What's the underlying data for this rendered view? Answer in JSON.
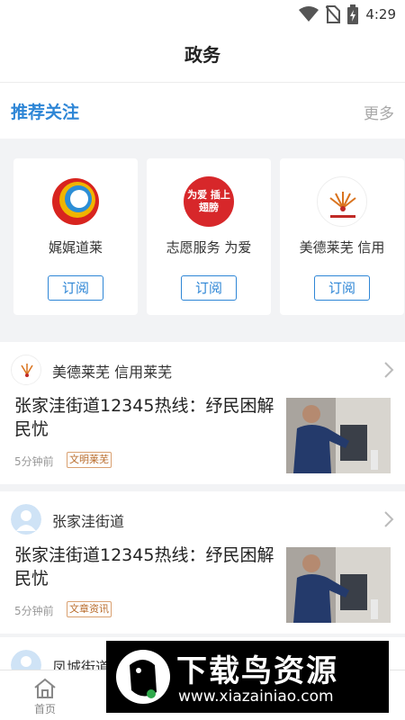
{
  "status_bar": {
    "time": "4:29"
  },
  "header": {
    "title": "政务"
  },
  "recommend": {
    "title": "推荐关注",
    "more": "更多",
    "cards": [
      {
        "name": "娓娓道莱",
        "subscribe_label": "订阅",
        "logo": "ring-logo-icon"
      },
      {
        "name": "志愿服务  为爱",
        "subscribe_label": "订阅",
        "logo": "volunteer-logo",
        "logo_text": "为爱 插上翅膀"
      },
      {
        "name": "美德莱芜  信用",
        "subscribe_label": "订阅",
        "logo": "virtue-logo-icon"
      }
    ]
  },
  "feed": [
    {
      "author": "美德莱芜  信用莱芜",
      "headline": "张家洼街道12345热线：纾民困解民忧",
      "time": "5分钟前",
      "tag": "文明莱芜"
    },
    {
      "author": "张家洼街道",
      "headline": "张家洼街道12345热线：纾民困解民忧",
      "time": "5分钟前",
      "tag": "文章资讯"
    },
    {
      "author": "凤城街道"
    }
  ],
  "bottom_nav": {
    "home_label": "首页"
  },
  "watermark": {
    "line1": "下载鸟资源",
    "line2": "www.xiazainiao.com"
  },
  "colors": {
    "accent": "#2e86d6",
    "tag": "#b86b2a",
    "background": "#f2f3f5"
  }
}
